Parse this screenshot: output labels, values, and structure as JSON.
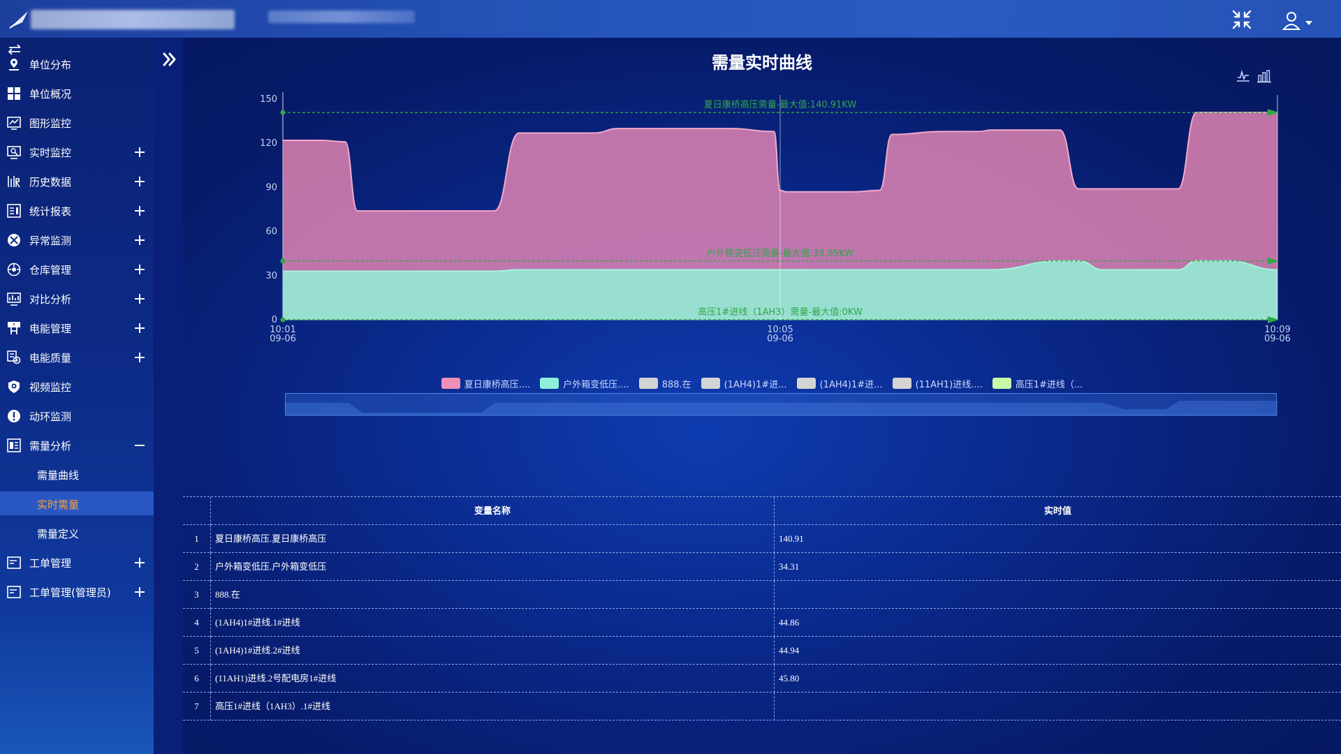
{
  "sidebar": {
    "items": [
      {
        "label": "单位分布",
        "icon": "map-pin-icon",
        "expand": ""
      },
      {
        "label": "单位概况",
        "icon": "grid-icon",
        "expand": ""
      },
      {
        "label": "图形监控",
        "icon": "monitor-graph-icon",
        "expand": ""
      },
      {
        "label": "实时监控",
        "icon": "realtime-monitor-icon",
        "expand": "plus"
      },
      {
        "label": "历史数据",
        "icon": "history-data-icon",
        "expand": "plus"
      },
      {
        "label": "统计报表",
        "icon": "report-icon",
        "expand": "plus"
      },
      {
        "label": "异常监测",
        "icon": "alert-tool-icon",
        "expand": "plus"
      },
      {
        "label": "仓库管理",
        "icon": "warehouse-icon",
        "expand": "plus"
      },
      {
        "label": "对比分析",
        "icon": "compare-chart-icon",
        "expand": "plus"
      },
      {
        "label": "电能管理",
        "icon": "power-tower-icon",
        "expand": "plus"
      },
      {
        "label": "电能质量",
        "icon": "power-quality-icon",
        "expand": "plus"
      },
      {
        "label": "视频监控",
        "icon": "camera-icon",
        "expand": ""
      },
      {
        "label": "动环监测",
        "icon": "exclamation-icon",
        "expand": ""
      },
      {
        "label": "需量分析",
        "icon": "demand-analysis-icon",
        "expand": "minus"
      }
    ],
    "sub_items": [
      {
        "label": "需量曲线",
        "active": false
      },
      {
        "label": "实时需量",
        "active": true
      },
      {
        "label": "需量定义",
        "active": false
      }
    ],
    "items_after": [
      {
        "label": "工单管理",
        "icon": "work-order-icon",
        "expand": "plus"
      },
      {
        "label": "工单管理(管理员)",
        "icon": "work-order-admin-icon",
        "expand": "plus"
      }
    ]
  },
  "main": {
    "title": "需量实时曲线"
  },
  "chart_data": {
    "type": "area",
    "title": "需量实时曲线",
    "ylim": [
      0,
      150
    ],
    "y_ticks": [
      0,
      30,
      60,
      90,
      120,
      150
    ],
    "x_ticks": [
      {
        "time": "10:01",
        "date": "09-06"
      },
      {
        "time": "10:05",
        "date": "09-06"
      },
      {
        "time": "10:09",
        "date": "09-06"
      }
    ],
    "x_minutes": [
      0,
      0.3,
      0.5,
      0.6,
      1.7,
      1.9,
      2.0,
      2.5,
      2.7,
      3.5,
      3.6,
      3.95,
      4.0,
      4.05,
      4.3,
      4.6,
      4.8,
      4.9,
      5.3,
      5.6,
      5.7,
      6.25,
      6.4,
      6.6,
      7.2,
      7.35,
      7.6,
      8.0
    ],
    "series": [
      {
        "name": "夏日康桥高压....",
        "color": "#f08fb8",
        "values": [
          122,
          122,
          121,
          74,
          74,
          127,
          127,
          127,
          130,
          130,
          130,
          128,
          88,
          87,
          87,
          87,
          88,
          126,
          128,
          128,
          129,
          129,
          89,
          89,
          89,
          141,
          141,
          141
        ]
      },
      {
        "name": "户外箱变低压....",
        "color": "#8ef0d8",
        "values": [
          33,
          33,
          33,
          33,
          33,
          34,
          34,
          34,
          34,
          34,
          34,
          34,
          34,
          34,
          34,
          34,
          34,
          34,
          34,
          34,
          34,
          40,
          40,
          34,
          34,
          40,
          40,
          34
        ]
      },
      {
        "name": "888.在",
        "color": "#d4d4d4",
        "values": []
      },
      {
        "name": "(1AH4)1#进...",
        "color": "#d4d4d4",
        "values": []
      },
      {
        "name": "(1AH4)1#进...",
        "color": "#d4d4d4",
        "values": []
      },
      {
        "name": "(11AH1)进线....",
        "color": "#d4d4d4",
        "values": []
      },
      {
        "name": "高压1#进线（...",
        "color": "#c8f7a8",
        "values": [
          0,
          0,
          0,
          0,
          0,
          0,
          0,
          0,
          0,
          0,
          0,
          0,
          0,
          0,
          0,
          0,
          0,
          0,
          0,
          0,
          0,
          0,
          0,
          0,
          0,
          0,
          0,
          0
        ]
      }
    ],
    "mark_lines": [
      {
        "label": "夏日康桥高压需量-最大值:140.91KW",
        "value": 140.91
      },
      {
        "label": "户外箱变低压需量-最大值:39.95KW",
        "value": 39.95
      },
      {
        "label": "高压1#进线（1AH3）需量-最大值:0KW",
        "value": 0
      }
    ],
    "cursor_minute": 4.0
  },
  "table": {
    "headers": {
      "index": "",
      "name": "变量名称",
      "value": "实时值"
    },
    "rows": [
      {
        "index": "1",
        "name": "夏日康桥高压.夏日康桥高压",
        "value": "140.91"
      },
      {
        "index": "2",
        "name": "户外箱变低压.户外箱变低压",
        "value": "34.31"
      },
      {
        "index": "3",
        "name": "888.在",
        "value": ""
      },
      {
        "index": "4",
        "name": "(1AH4)1#进线.1#进线",
        "value": "44.86"
      },
      {
        "index": "5",
        "name": "(1AH4)1#进线.2#进线",
        "value": "44.94"
      },
      {
        "index": "6",
        "name": "(11AH1)进线.2号配电房1#进线",
        "value": "45.80"
      },
      {
        "index": "7",
        "name": "高压1#进线（1AH3）.1#进线",
        "value": ""
      }
    ]
  },
  "colors": {
    "accent_active": "#f6a23c",
    "markline": "#2fa84a"
  }
}
